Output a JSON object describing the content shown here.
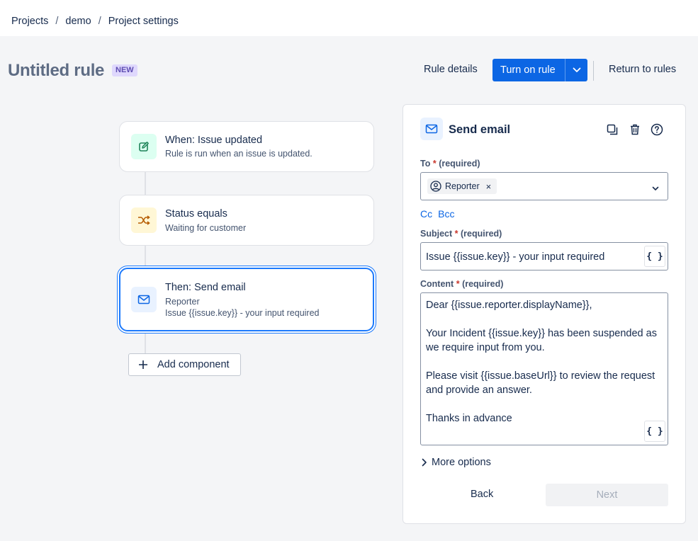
{
  "breadcrumb": {
    "items": [
      "Projects",
      "demo",
      "Project settings"
    ],
    "separator": "/"
  },
  "header": {
    "title": "Untitled rule",
    "badge": "NEW",
    "rule_details": "Rule details",
    "turn_on_rule": "Turn on rule",
    "return_to_rules": "Return to rules"
  },
  "flow": {
    "trigger": {
      "title": "When: Issue updated",
      "subtitle": "Rule is run when an issue is updated.",
      "icon": "edit-icon"
    },
    "condition": {
      "title": "Status equals",
      "subtitle": "Waiting for customer",
      "icon": "shuffle-icon"
    },
    "action": {
      "title": "Then: Send email",
      "subtitle_1": "Reporter",
      "subtitle_2": "Issue {{issue.key}} - your input required",
      "icon": "email-icon"
    },
    "add_component": "Add component"
  },
  "panel": {
    "title": "Send email",
    "icon": "email-icon",
    "to_label": "To",
    "required_star": "*",
    "required_hint": "(required)",
    "to_chip": "Reporter",
    "cc": "Cc",
    "bcc": "Bcc",
    "subject_label": "Subject",
    "subject_value": "Issue {{issue.key}} - your input required",
    "brace": "{ }",
    "content_label": "Content",
    "content_lines": [
      "Dear {{issue.reporter.displayName}},",
      "",
      "Your Incident {{issue.key}} has been suspended as",
      "we require input from you.",
      "",
      "Please visit {{issue.baseUrl}} to review the request",
      "and provide an answer.",
      "",
      "Thanks in advance"
    ],
    "more_options": "More options",
    "back": "Back",
    "next": "Next"
  },
  "colors": {
    "primary": "#0c66e4",
    "badge_bg": "#dfd8fd",
    "badge_text": "#5e4db2",
    "required": "#c9372c"
  }
}
